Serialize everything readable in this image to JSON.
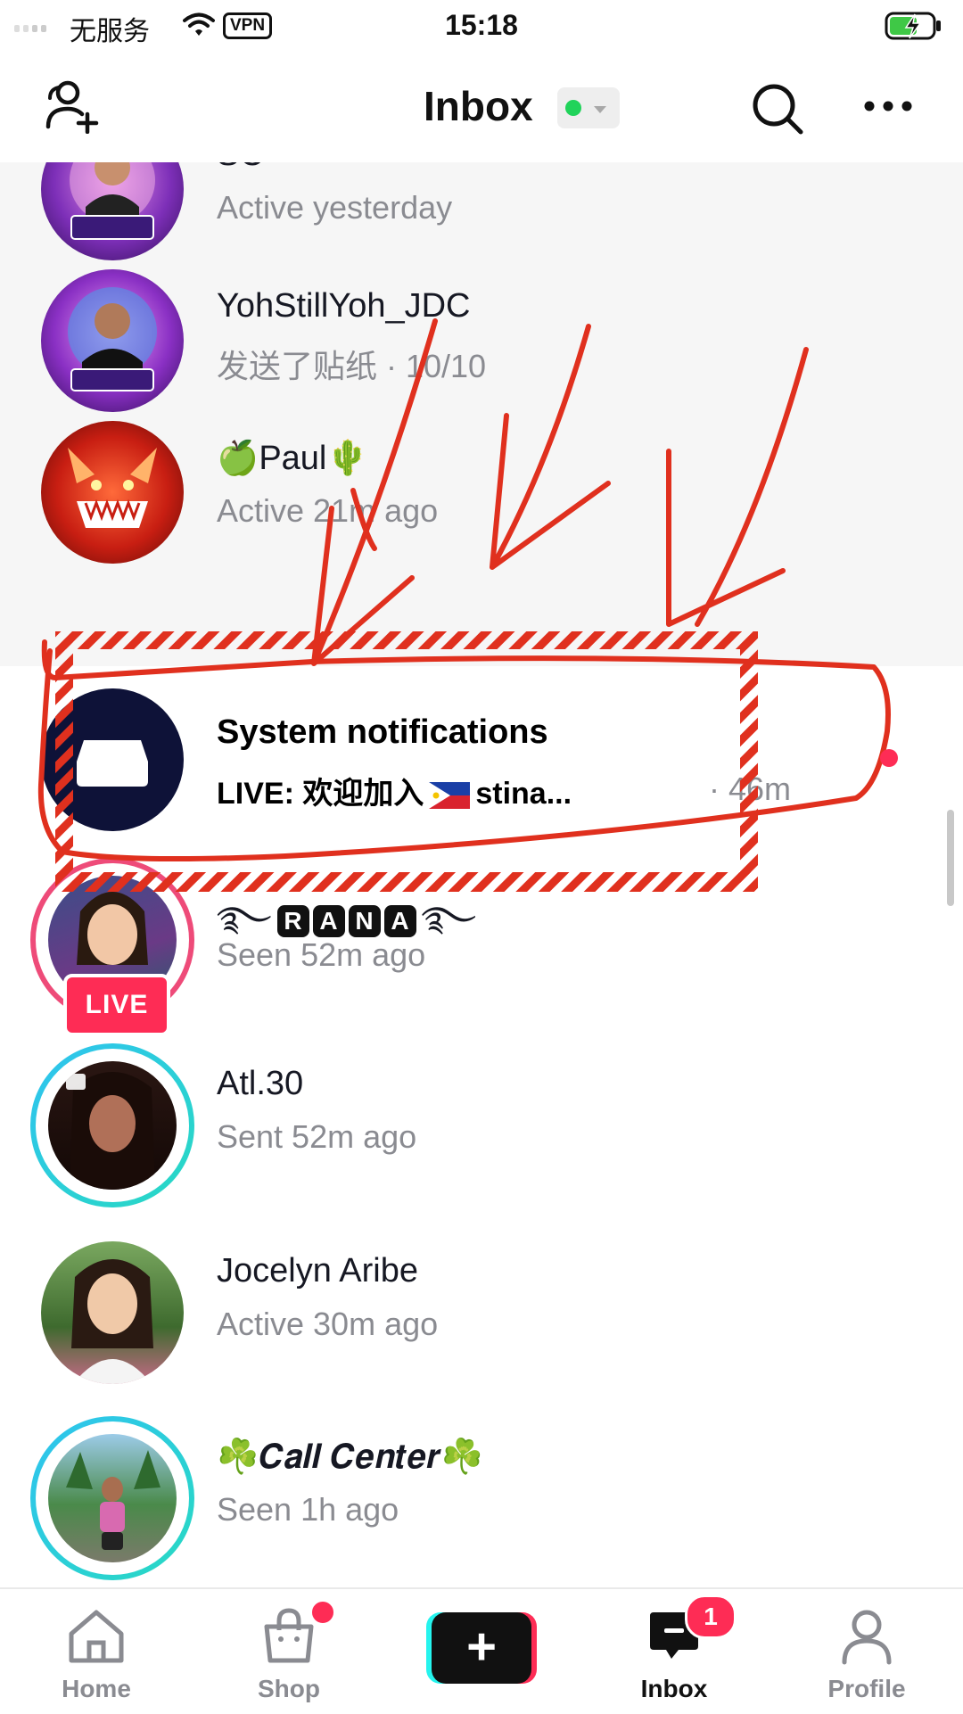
{
  "status_bar": {
    "carrier": "无服务",
    "vpn": "VPN",
    "time": "15:18"
  },
  "header": {
    "title": "Inbox",
    "online_status_color": "#20d35a"
  },
  "icons": {
    "add_friends": "add-friends-icon",
    "search": "search-icon",
    "more": "more-icon"
  },
  "conversations": [
    {
      "name": "SC",
      "subtitle": "Active yesterday",
      "avatar_badge": "SC_14"
    },
    {
      "name": "YohStillYoh_JDC",
      "subtitle": "发送了贴纸 · 10/10",
      "avatar_badge": "YohStillYoh"
    },
    {
      "name": "🍏Paul🌵",
      "subtitle": "Active 21m ago"
    },
    {
      "name": "System notifications",
      "subtitle": "LIVE: 欢迎加入",
      "subtitle_tail": "stina...",
      "time": "· 46m"
    },
    {
      "name_prefix": "࿐",
      "name_letters": [
        "R",
        "A",
        "N",
        "A"
      ],
      "name_suffix": "࿐",
      "subtitle": "Seen 52m ago",
      "live_label": "LIVE"
    },
    {
      "name": "Atl.30",
      "subtitle": "Sent 52m ago"
    },
    {
      "name": "Jocelyn Aribe",
      "subtitle": "Active 30m ago"
    },
    {
      "name": "☘️𝑪𝒂𝒍𝒍 𝑪𝒆𝒏𝒕𝒆𝒓☘️",
      "subtitle": "Seen 1h ago"
    }
  ],
  "tab_bar": {
    "home": "Home",
    "shop": "Shop",
    "inbox": "Inbox",
    "inbox_badge": "1",
    "profile": "Profile"
  },
  "colors": {
    "accent_red": "#fe2c55",
    "annotation_red": "#e0301e",
    "muted_text": "#8a8b91"
  }
}
